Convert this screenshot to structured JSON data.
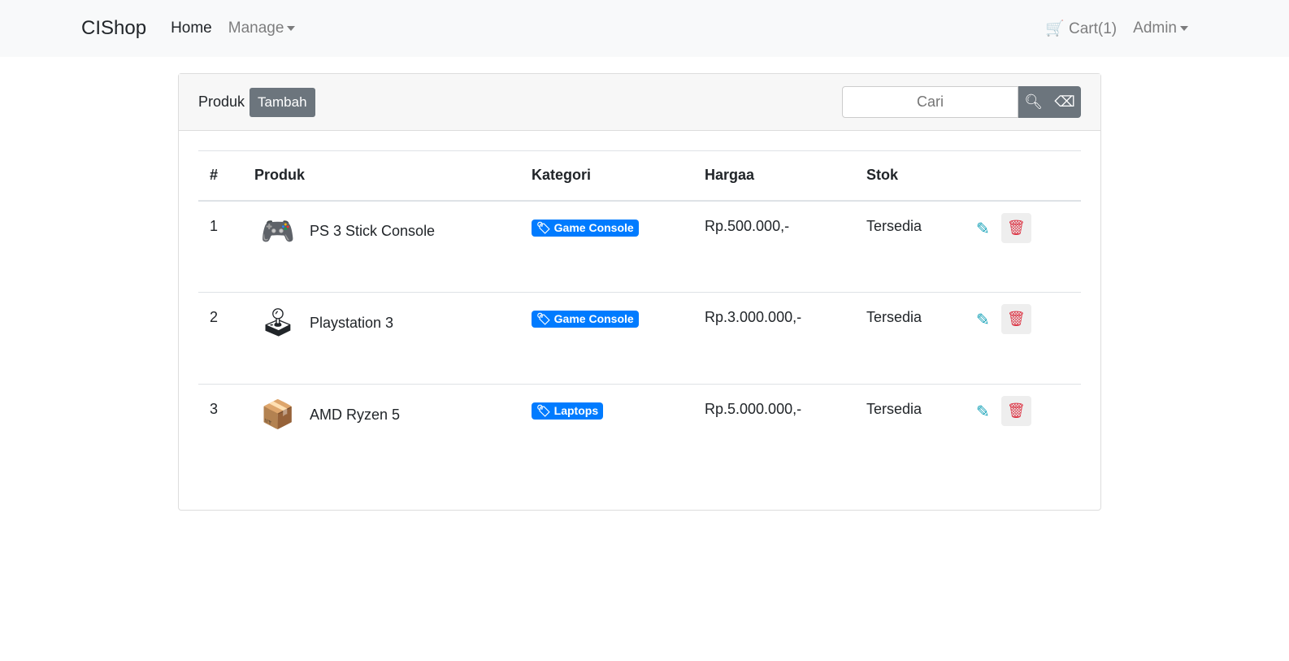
{
  "navbar": {
    "brand": "CIShop",
    "home": "Home",
    "manage": "Manage",
    "cart": "Cart(1)",
    "admin": "Admin"
  },
  "card": {
    "title": "Produk",
    "add_label": "Tambah",
    "search_placeholder": "Cari"
  },
  "table": {
    "headers": [
      "#",
      "Produk",
      "Kategori",
      "Hargaa",
      "Stok"
    ],
    "rows": [
      {
        "no": "1",
        "name": "PS 3 Stick Console",
        "category": "Game Console",
        "price": "Rp.500.000,-",
        "stock": "Tersedia"
      },
      {
        "no": "2",
        "name": "Playstation 3",
        "category": "Game Console",
        "price": "Rp.3.000.000,-",
        "stock": "Tersedia"
      },
      {
        "no": "3",
        "name": "AMD Ryzen 5",
        "category": "Laptops",
        "price": "Rp.5.000.000,-",
        "stock": "Tersedia"
      }
    ]
  }
}
